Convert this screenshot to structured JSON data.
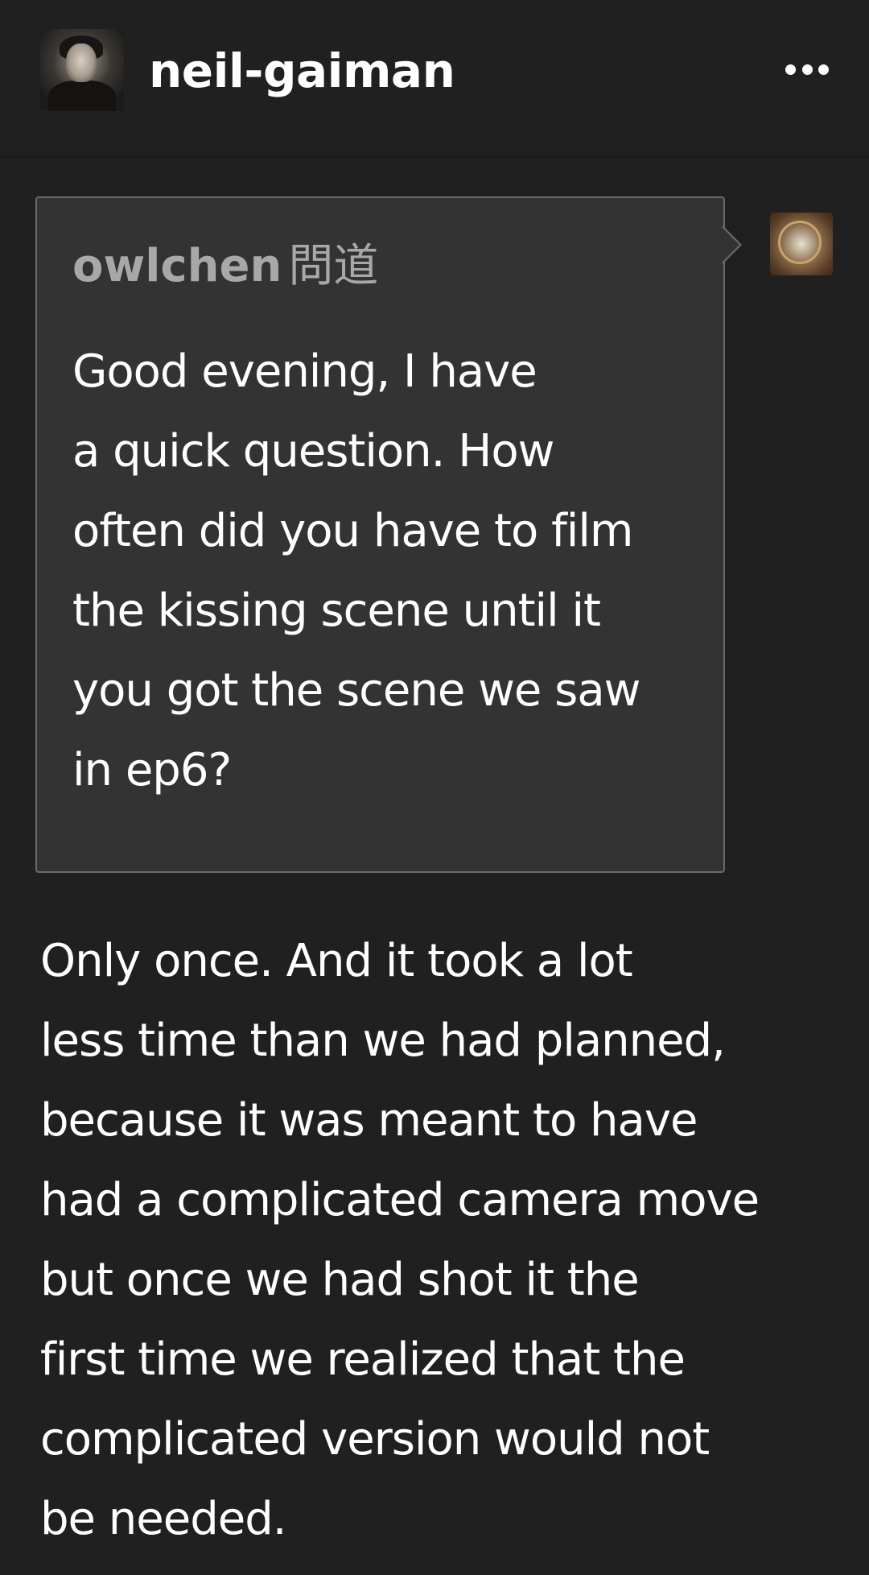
{
  "header": {
    "blog_name": "neil-gaiman",
    "more_icon": "more-horizontal-icon"
  },
  "ask": {
    "asker": "owlchen",
    "verb": "問道",
    "question_lines": [
      "Good evening, I have",
      "a quick question. How",
      "often did you have to film",
      "the kissing scene until it",
      "you got the scene we saw",
      "in ep6?"
    ]
  },
  "answer": {
    "lines": [
      "Only once. And it took a lot",
      "less time than we had planned,",
      "because it was meant to have",
      "had a complicated camera move",
      "but once we had shot it the",
      "first time we realized that the",
      "complicated version would not",
      "be needed."
    ]
  },
  "colors": {
    "background": "#202020",
    "ask_box": "#333333",
    "ask_border": "#6a6a6a",
    "asker_name": "#a8a8a8",
    "text": "#ffffff"
  }
}
